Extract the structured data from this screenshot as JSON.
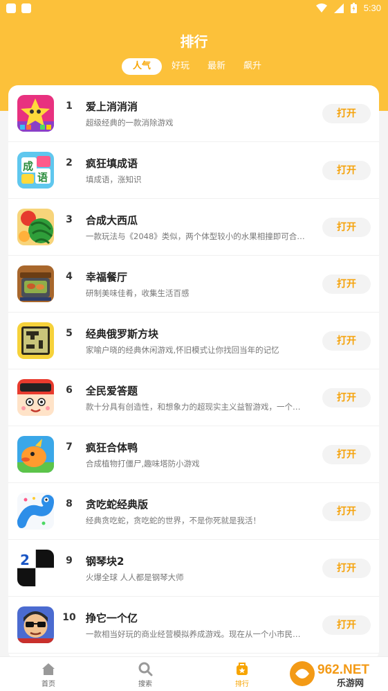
{
  "status_bar": {
    "time": "5:30"
  },
  "header": {
    "title": "排行"
  },
  "tabs": [
    {
      "label": "人气",
      "active": true
    },
    {
      "label": "好玩",
      "active": false
    },
    {
      "label": "最新",
      "active": false
    },
    {
      "label": "飙升",
      "active": false
    }
  ],
  "apps": [
    {
      "rank": "1",
      "name": "爱上消消消",
      "desc": "超级经典的一款消除游戏",
      "button": "打开",
      "icon": "star-match-game-icon"
    },
    {
      "rank": "2",
      "name": "疯狂填成语",
      "desc": "填成语，涨知识",
      "button": "打开",
      "icon": "idiom-game-icon"
    },
    {
      "rank": "3",
      "name": "合成大西瓜",
      "desc": "一款玩法与《2048》类似，两个体型较小的水果相撞即可合…",
      "button": "打开",
      "icon": "watermelon-icon"
    },
    {
      "rank": "4",
      "name": "幸福餐厅",
      "desc": "研制美味佳肴，收集生活百感",
      "button": "打开",
      "icon": "restaurant-grill-icon"
    },
    {
      "rank": "5",
      "name": "经典俄罗斯方块",
      "desc": "家喻户晓的经典休闲游戏,怀旧模式让你找回当年的记忆",
      "button": "打开",
      "icon": "tetris-icon"
    },
    {
      "rank": "6",
      "name": "全民爱答题",
      "desc": "款十分具有创造性，和想象力的超现实主义益智游戏，一个…",
      "button": "打开",
      "icon": "quiz-face-icon"
    },
    {
      "rank": "7",
      "name": "疯狂合体鸭",
      "desc": "合成植物打僵尸,趣味塔防小游戏",
      "button": "打开",
      "icon": "duck-icon"
    },
    {
      "rank": "8",
      "name": "贪吃蛇经典版",
      "desc": "经典贪吃蛇，贪吃蛇的世界，不是你死就是我活！",
      "button": "打开",
      "icon": "snake-icon"
    },
    {
      "rank": "9",
      "name": "钢琴块2",
      "desc": "火爆全球 人人都是钢琴大师",
      "button": "打开",
      "icon": "piano-tiles-icon"
    },
    {
      "rank": "10",
      "name": "挣它一个亿",
      "desc": "一款相当好玩的商业经营模拟养成游戏。现在从一个小市民…",
      "button": "打开",
      "icon": "businessman-icon"
    }
  ],
  "bottom_nav": [
    {
      "label": "首页",
      "icon": "home-icon",
      "active": false
    },
    {
      "label": "搜索",
      "icon": "search-icon",
      "active": false
    },
    {
      "label": "排行",
      "icon": "ranking-icon",
      "active": true
    }
  ],
  "watermark": {
    "text": "962.NET",
    "subtext": "乐游网"
  },
  "colors": {
    "brand": "#fcc13a",
    "accent": "#f5a20a"
  }
}
